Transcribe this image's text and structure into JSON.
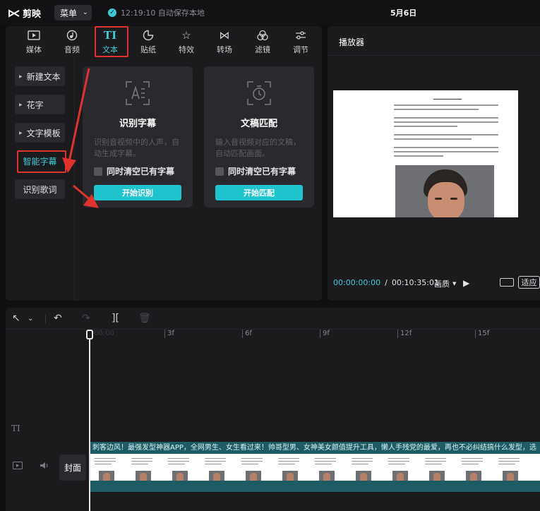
{
  "app": {
    "name": "剪映",
    "menu_label": "菜单",
    "autosave": "12:19:10 自动保存本地",
    "project_title": "5月6日"
  },
  "tabs": [
    {
      "label": "媒体",
      "icon": "media-icon"
    },
    {
      "label": "音频",
      "icon": "audio-icon"
    },
    {
      "label": "文本",
      "icon": "text-icon",
      "active": true
    },
    {
      "label": "贴纸",
      "icon": "sticker-icon"
    },
    {
      "label": "特效",
      "icon": "effects-icon"
    },
    {
      "label": "转场",
      "icon": "transition-icon"
    },
    {
      "label": "滤镜",
      "icon": "filter-icon"
    },
    {
      "label": "调节",
      "icon": "adjust-icon"
    }
  ],
  "sidebar": {
    "items": [
      {
        "label": "新建文本"
      },
      {
        "label": "花字"
      },
      {
        "label": "文字模板"
      },
      {
        "label": "智能字幕",
        "active": true
      },
      {
        "label": "识别歌词"
      }
    ]
  },
  "cards": [
    {
      "title": "识别字幕",
      "desc": "识别音视频中的人声，自动生成字幕。",
      "check": "同时清空已有字幕",
      "button": "开始识别"
    },
    {
      "title": "文稿匹配",
      "desc": "输入音视频对应的文稿，自动匹配画面。",
      "check": "同时清空已有字幕",
      "button": "开始匹配"
    }
  ],
  "player": {
    "title": "播放器",
    "current_time": "00:00:00:00",
    "total_time": "00:10:35:01",
    "quality": "画质",
    "fit": "适应"
  },
  "timeline": {
    "ticks": [
      "00:00",
      "3f",
      "6f",
      "9f",
      "12f",
      "15f"
    ],
    "cover_label": "封面",
    "subtitle_text": "刺客边风！最强发型神器APP，全网男生、女生看过来！帅哥型男、女神美女颜值提升工具，懒人手残党的最爱，再也不必纠结搞什么发型，选"
  },
  "colors": {
    "accent": "#3ec9d6",
    "highlight": "#e0332d",
    "button": "#1fc4cf"
  }
}
